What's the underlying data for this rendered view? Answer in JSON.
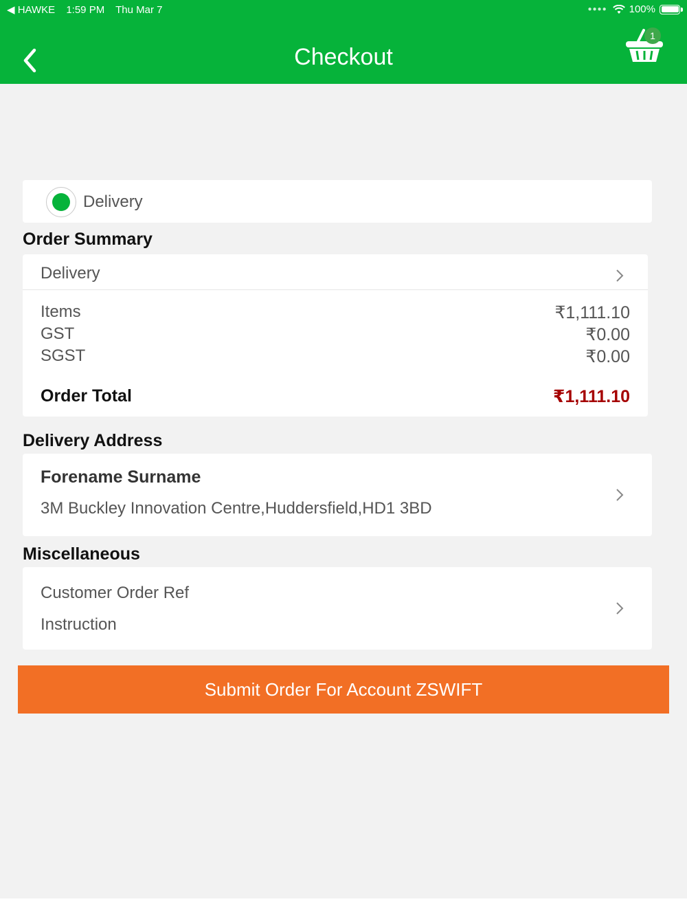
{
  "status_bar": {
    "carrier": "◀ HAWKE",
    "time": "1:59 PM",
    "date": "Thu Mar 7",
    "battery": "100%"
  },
  "header": {
    "title": "Checkout",
    "cart_count": "1"
  },
  "delivery_option": {
    "label": "Delivery",
    "selected": true
  },
  "order_summary": {
    "title": "Order Summary",
    "method": "Delivery",
    "lines": [
      {
        "label": "Items",
        "value": "₹1,111.10"
      },
      {
        "label": "GST",
        "value": "₹0.00"
      },
      {
        "label": "SGST",
        "value": "₹0.00"
      }
    ],
    "total_label": "Order Total",
    "total_value": "₹1,111.10"
  },
  "delivery_address": {
    "title": "Delivery Address",
    "name": "Forename Surname",
    "address": "3M Buckley Innovation Centre,Huddersfield,HD1 3BD"
  },
  "miscellaneous": {
    "title": "Miscellaneous",
    "order_ref_label": "Customer Order Ref",
    "instruction_label": "Instruction"
  },
  "submit_label": "Submit Order For Account ZSWIFT",
  "colors": {
    "header_green": "#06b33a",
    "submit_orange": "#f26f25",
    "total_red": "#a50000"
  }
}
